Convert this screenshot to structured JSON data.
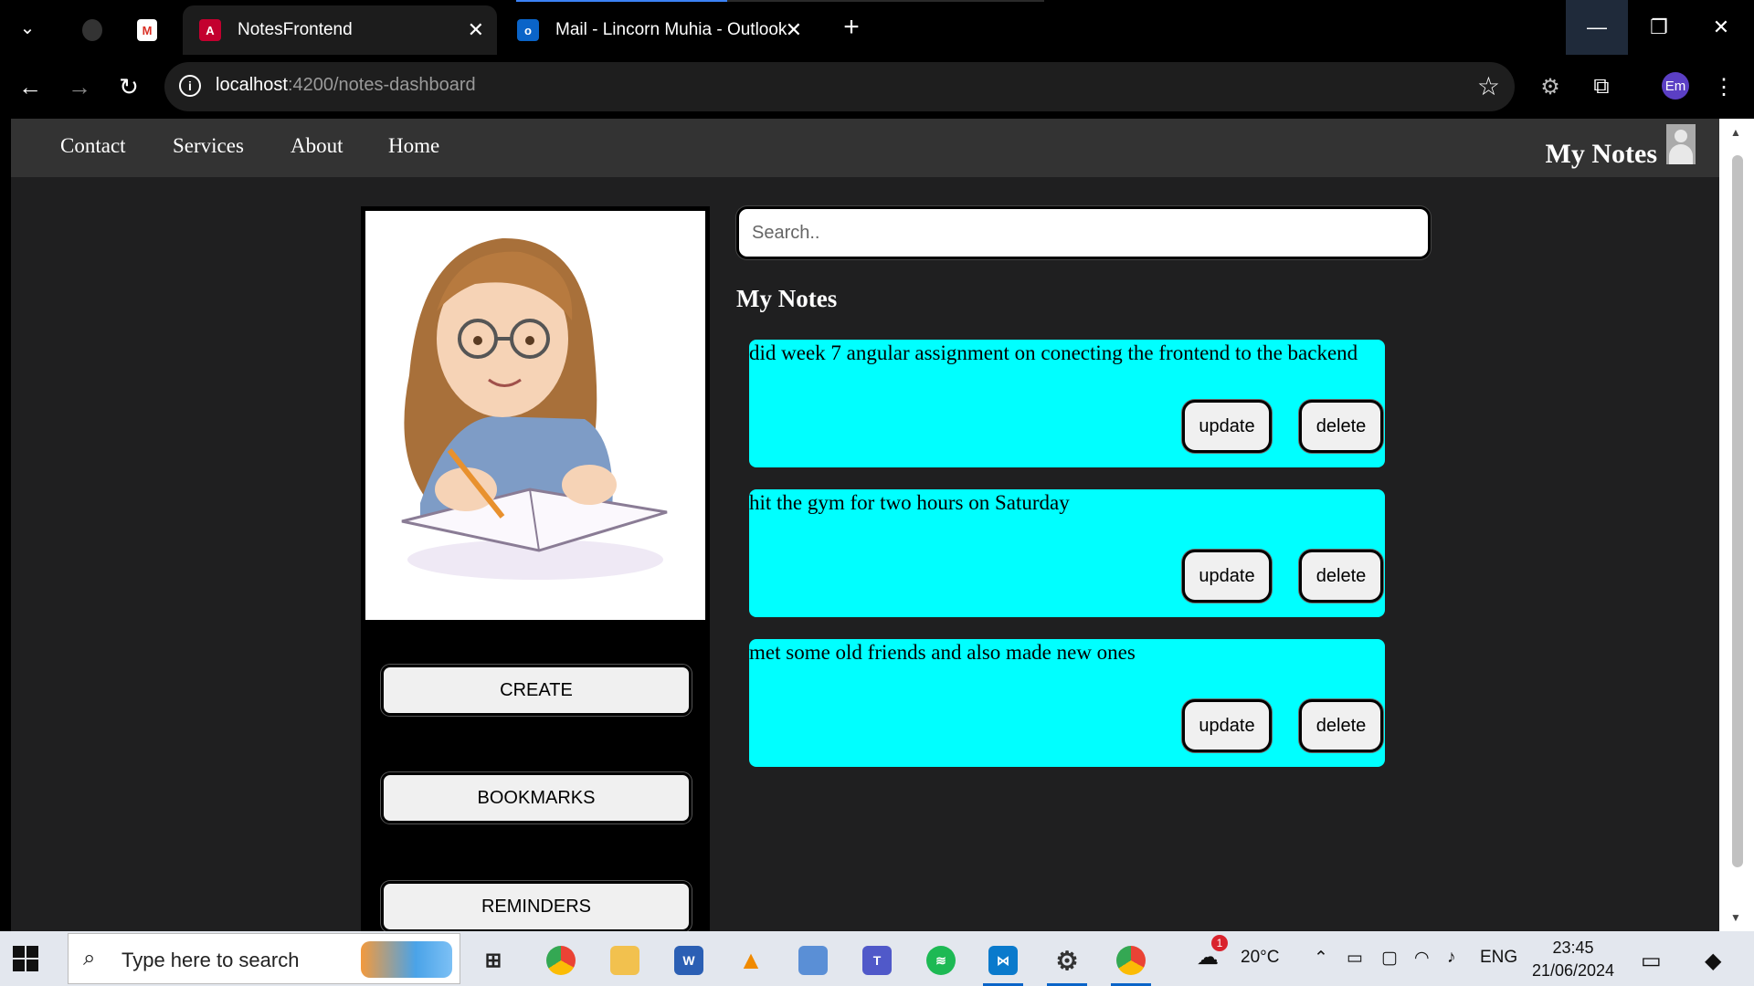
{
  "browser": {
    "tabs": [
      {
        "title": "",
        "icon": "github-icon"
      },
      {
        "title": "",
        "icon": "gmail-icon"
      },
      {
        "title": "NotesFrontend",
        "icon": "angular-icon",
        "active": true
      },
      {
        "title": "Mail - Lincorn Muhia - Outlook",
        "icon": "outlook-icon"
      }
    ],
    "url_host": "localhost",
    "url_path": ":4200/notes-dashboard",
    "profile_initials": "Em"
  },
  "app": {
    "nav": [
      "Contact",
      "Services",
      "About",
      "Home"
    ],
    "brand": "My Notes",
    "search_placeholder": "Search..",
    "section_title": "My Notes",
    "sidebar_buttons": [
      "CREATE",
      "BOOKMARKS",
      "REMINDERS"
    ],
    "notes": [
      {
        "text": "did week 7 angular assignment on conecting the frontend to the backend",
        "update_label": "update",
        "delete_label": "delete"
      },
      {
        "text": "hit the gym for two hours on Saturday",
        "update_label": "update",
        "delete_label": "delete"
      },
      {
        "text": "met some old friends and also made new ones",
        "update_label": "update",
        "delete_label": "delete"
      }
    ],
    "note_color": "#00ffff"
  },
  "taskbar": {
    "search_placeholder": "Type here to search",
    "weather": "20°C",
    "weather_badge": "1",
    "language": "ENG",
    "time": "23:45",
    "date": "21/06/2024"
  }
}
